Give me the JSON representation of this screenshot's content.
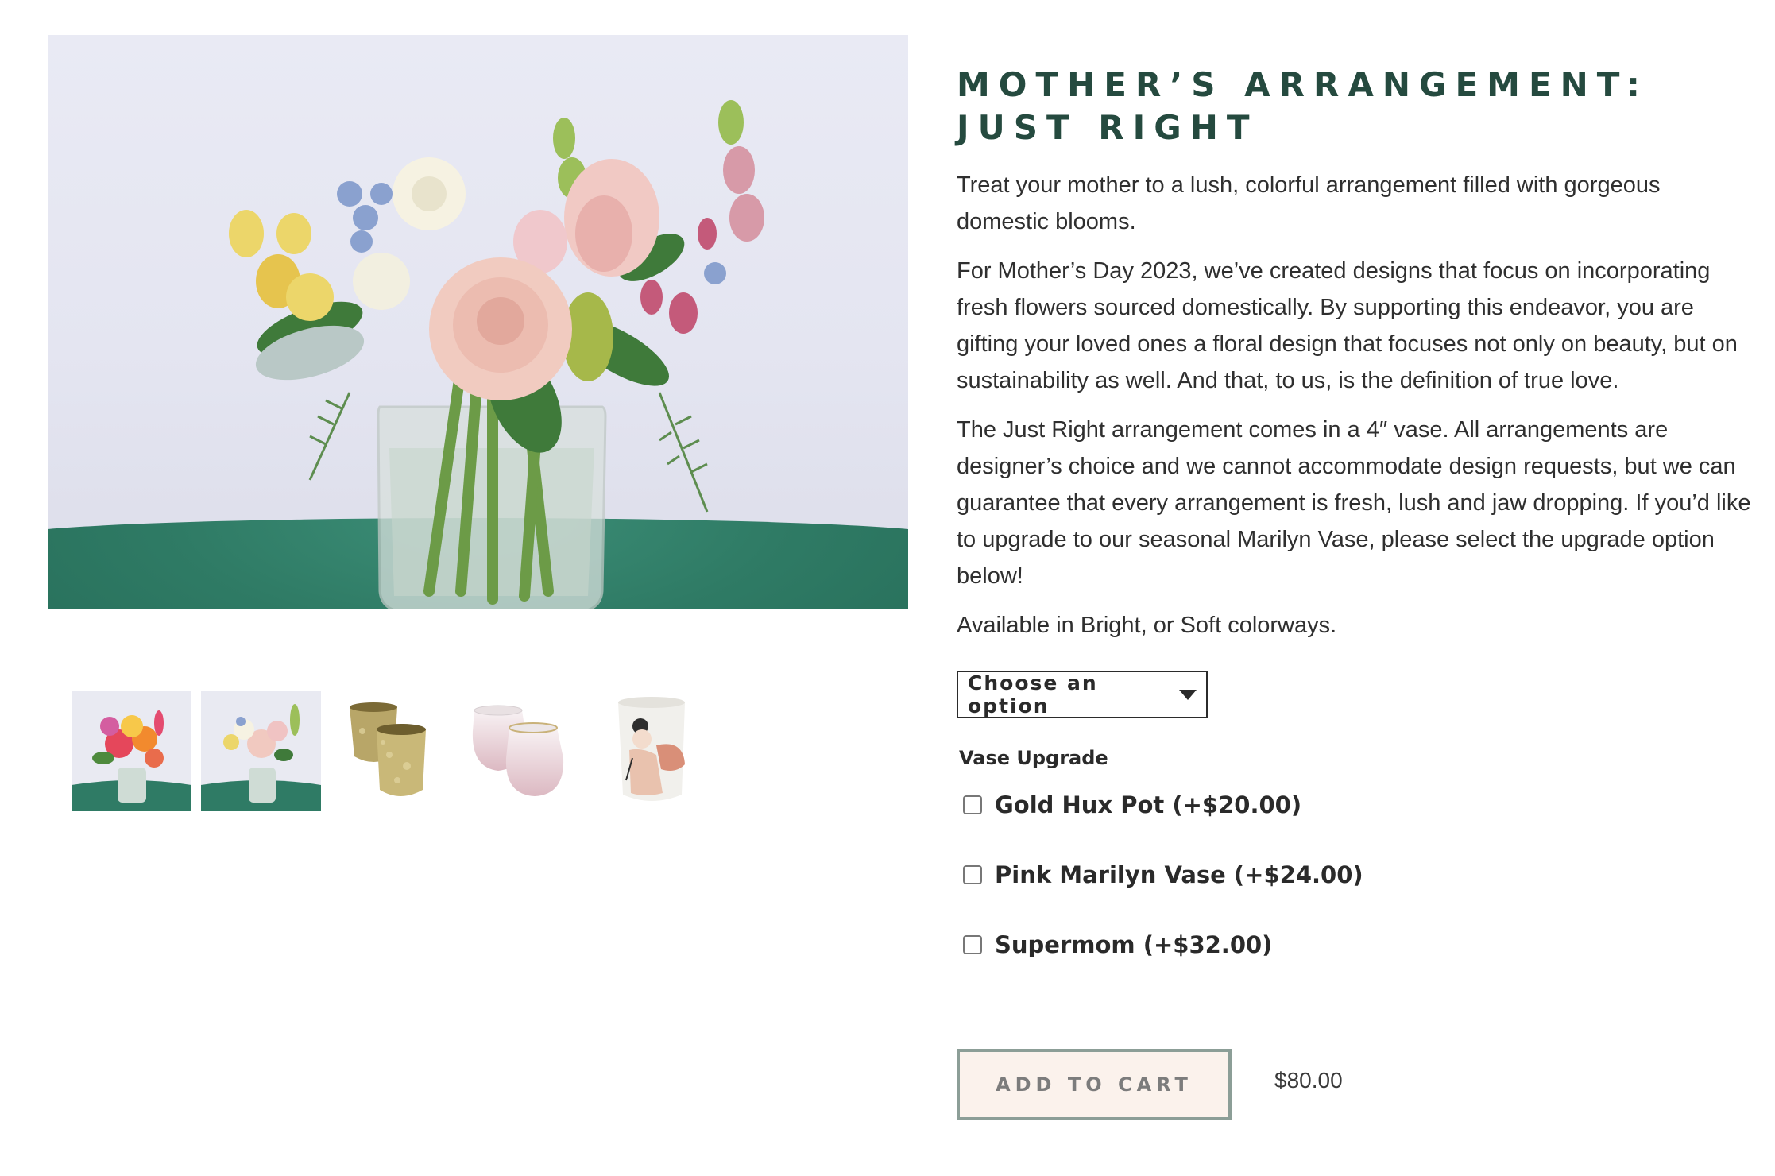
{
  "product": {
    "title": "Mother’s Arrangement: Just Right",
    "description": [
      "Treat your mother to a lush, colorful arrangement filled with gorgeous domestic blooms.",
      "For Mother’s Day 2023, we’ve created designs that focus on incorporating fresh flowers sourced domestically. By supporting this endeavor, you are gifting your loved ones a floral design that focuses not only on beauty, but on sustainability as well. And that, to us, is the definition of true love.",
      "The Just Right arrangement comes in a 4″ vase. All arrangements are designer’s choice and we cannot accommodate design requests, but we can guarantee that every arrangement is fresh, lush and jaw dropping. If you’d like to upgrade to our seasonal Marilyn Vase, please select the upgrade option below!",
      "Available in Bright, or Soft colorways."
    ],
    "price": "$80.00"
  },
  "variation": {
    "selected": "Choose an option"
  },
  "addons": {
    "heading": "Vase Upgrade",
    "items": [
      {
        "label": "Gold Hux Pot (+$20.00)",
        "checked": false
      },
      {
        "label": "Pink Marilyn Vase (+$24.00)",
        "checked": false
      },
      {
        "label": "Supermom (+$32.00)",
        "checked": false
      }
    ]
  },
  "cart": {
    "button_label": "ADD TO CART"
  },
  "colors": {
    "title": "#254a3f",
    "table_green": "#2f7b65",
    "button_bg": "#fbf2ec",
    "button_border": "#8c9e97"
  }
}
